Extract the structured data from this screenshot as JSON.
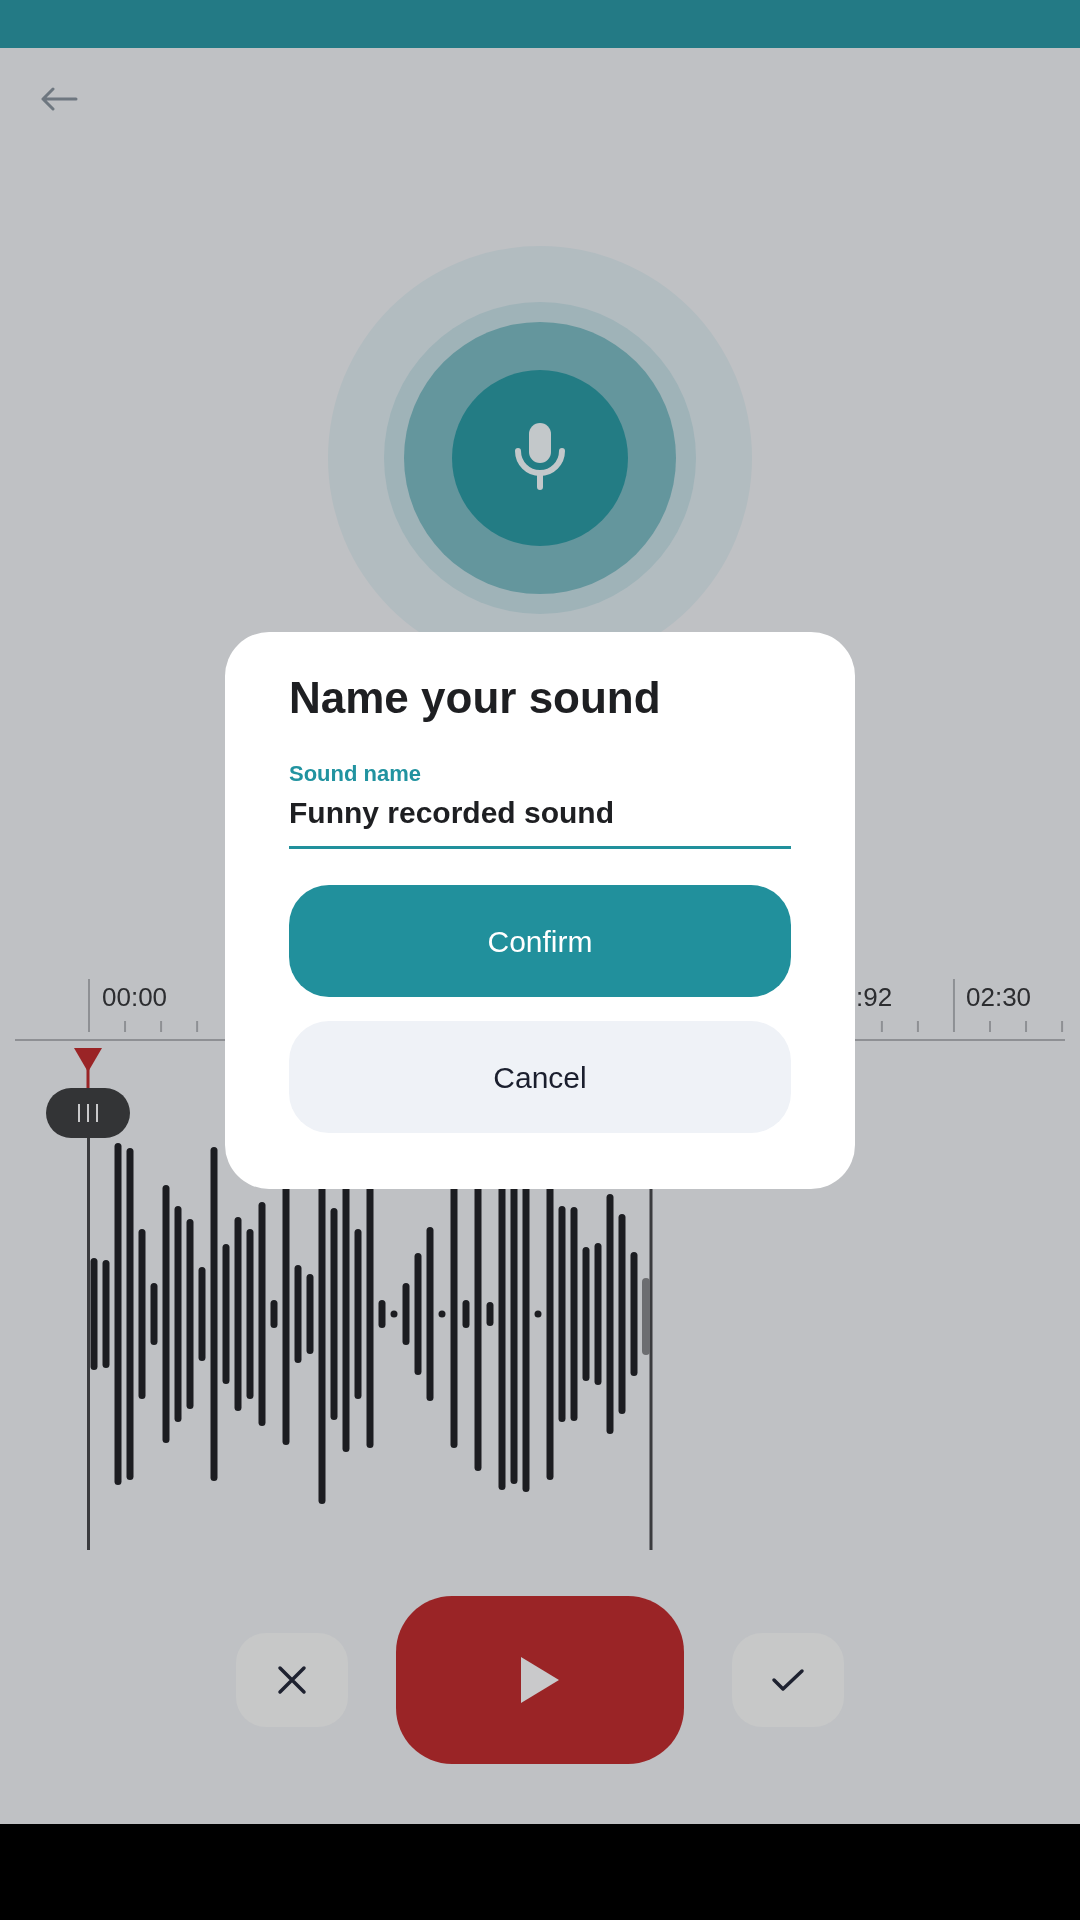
{
  "timeline": {
    "labels": [
      "00:00",
      ":92",
      "02:30"
    ]
  },
  "dialog": {
    "title": "Name your sound",
    "field": {
      "label": "Sound name",
      "value": "Funny recorded sound"
    },
    "buttons": [
      {
        "label": "Confirm",
        "kind": "primary"
      },
      {
        "label": "Cancel",
        "kind": "secondary"
      }
    ]
  }
}
